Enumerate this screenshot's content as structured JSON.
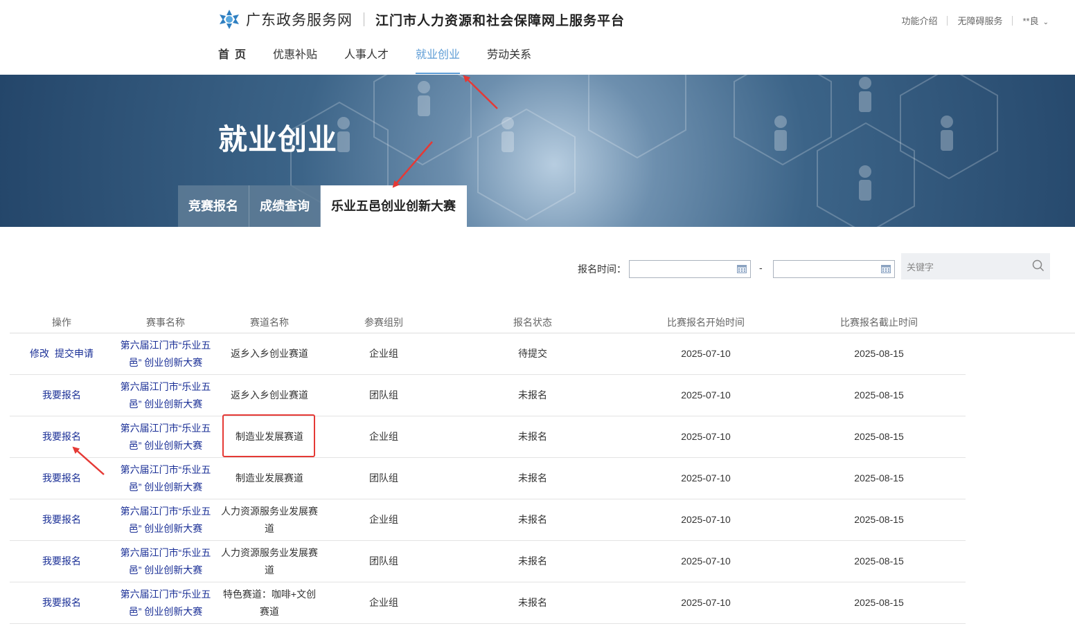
{
  "header": {
    "site_name": "广东政务服务网",
    "platform_name": "江门市人力资源和社会保障网上服务平台",
    "links": [
      "功能介绍",
      "无障碍服务"
    ],
    "user": "**良"
  },
  "nav": {
    "items": [
      {
        "label": "首页",
        "active": false
      },
      {
        "label": "优惠补贴",
        "active": false
      },
      {
        "label": "人事人才",
        "active": false
      },
      {
        "label": "就业创业",
        "active": true
      },
      {
        "label": "劳动关系",
        "active": false
      }
    ]
  },
  "banner": {
    "title": "就业创业",
    "tabs": [
      {
        "label": "竞赛报名",
        "active": false
      },
      {
        "label": "成绩查询",
        "active": false
      },
      {
        "label": "乐业五邑创业创新大赛",
        "active": true
      }
    ]
  },
  "filter": {
    "label": "报名时间：",
    "dash": "-",
    "start_date": "",
    "end_date": "",
    "keyword_placeholder": "关键字"
  },
  "table": {
    "columns": [
      "操作",
      "赛事名称",
      "赛道名称",
      "参赛组别",
      "报名状态",
      "比赛报名开始时间",
      "比赛报名截止时间"
    ],
    "rows": [
      {
        "actions": [
          "修改",
          "提交申请"
        ],
        "event": [
          "第六届江门市“乐业五",
          "邑” 创业创新大赛"
        ],
        "track": [
          "返乡入乡创业赛道"
        ],
        "group": "企业组",
        "status": "待提交",
        "start": "2025-07-10",
        "end": "2025-08-15"
      },
      {
        "actions": [
          "我要报名"
        ],
        "event": [
          "第六届江门市“乐业五",
          "邑” 创业创新大赛"
        ],
        "track": [
          "返乡入乡创业赛道"
        ],
        "group": "团队组",
        "status": "未报名",
        "start": "2025-07-10",
        "end": "2025-08-15"
      },
      {
        "actions": [
          "我要报名"
        ],
        "event": [
          "第六届江门市“乐业五",
          "邑” 创业创新大赛"
        ],
        "track": [
          "制造业发展赛道"
        ],
        "group": "企业组",
        "status": "未报名",
        "start": "2025-07-10",
        "end": "2025-08-15"
      },
      {
        "actions": [
          "我要报名"
        ],
        "event": [
          "第六届江门市“乐业五",
          "邑” 创业创新大赛"
        ],
        "track": [
          "制造业发展赛道"
        ],
        "group": "团队组",
        "status": "未报名",
        "start": "2025-07-10",
        "end": "2025-08-15"
      },
      {
        "actions": [
          "我要报名"
        ],
        "event": [
          "第六届江门市“乐业五",
          "邑” 创业创新大赛"
        ],
        "track": [
          "人力资源服务业发展赛",
          "道"
        ],
        "group": "企业组",
        "status": "未报名",
        "start": "2025-07-10",
        "end": "2025-08-15"
      },
      {
        "actions": [
          "我要报名"
        ],
        "event": [
          "第六届江门市“乐业五",
          "邑” 创业创新大赛"
        ],
        "track": [
          "人力资源服务业发展赛",
          "道"
        ],
        "group": "团队组",
        "status": "未报名",
        "start": "2025-07-10",
        "end": "2025-08-15"
      },
      {
        "actions": [
          "我要报名"
        ],
        "event": [
          "第六届江门市“乐业五",
          "邑” 创业创新大赛"
        ],
        "track": [
          "特色赛道：咖啡+文创",
          "赛道"
        ],
        "group": "企业组",
        "status": "未报名",
        "start": "2025-07-10",
        "end": "2025-08-15"
      }
    ]
  },
  "colors": {
    "accent": "#5b9bd5",
    "link": "#1a2f96",
    "annotation": "#e53935"
  }
}
